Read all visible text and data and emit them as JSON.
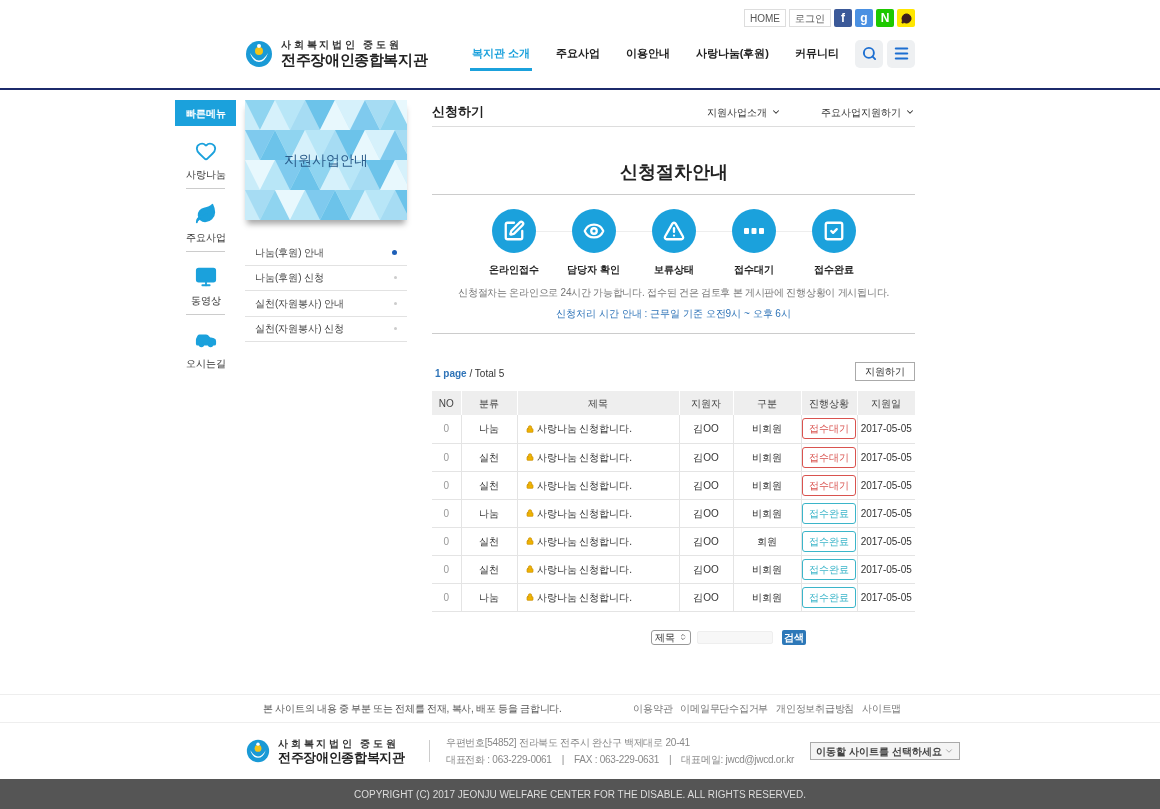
{
  "top_links": [
    {
      "label": "HOME"
    },
    {
      "label": "로그인"
    }
  ],
  "social": [
    {
      "kind": "facebook",
      "label": "f",
      "color": "#3b5998"
    },
    {
      "kind": "google",
      "label": "g",
      "color": "#4a90e2"
    },
    {
      "kind": "naver",
      "label": "N",
      "color": "#1ec800"
    },
    {
      "kind": "kakao",
      "color": "#ffe600"
    }
  ],
  "logo": {
    "subtitle": "사 회 복 지 법 인   중 도 원",
    "name": "전주장애인종합복지관"
  },
  "nav": [
    {
      "label": "복지관 소개",
      "selected": true
    },
    {
      "label": "주요사업",
      "selected": false
    },
    {
      "label": "이용안내",
      "selected": false
    },
    {
      "label": "사랑나눔(후원)",
      "selected": false
    },
    {
      "label": "커뮤니티",
      "selected": false
    }
  ],
  "quick_menu": {
    "title": "빠른메뉴",
    "items": [
      {
        "kind": "heart",
        "label": "사랑나눔"
      },
      {
        "kind": "leaf",
        "label": "주요사업"
      },
      {
        "kind": "monitor",
        "label": "동영상"
      },
      {
        "kind": "car",
        "label": "오시는길"
      }
    ]
  },
  "side": {
    "banner": "지원사업안내",
    "items": [
      {
        "label": "나눔(후원) 안내",
        "selected": true
      },
      {
        "label": "나눔(후원) 신청",
        "selected": false
      },
      {
        "label": "실천(자원봉사) 안내",
        "selected": false
      },
      {
        "label": "실천(자원봉사) 신청",
        "selected": false
      }
    ]
  },
  "page_title": "신청하기",
  "breadcrumbs": [
    {
      "label": "지원사업소개"
    },
    {
      "label": "주요사업지원하기"
    }
  ],
  "section_title": "신청절차안내",
  "steps": [
    {
      "kind": "edit",
      "label": "온라인접수"
    },
    {
      "kind": "eye",
      "label": "담당자 확인"
    },
    {
      "kind": "alert",
      "label": "보류상태"
    },
    {
      "kind": "dots",
      "label": "접수대기"
    },
    {
      "kind": "check",
      "label": "접수완료"
    }
  ],
  "notice": "신청절차는 온라인으로 24시간 가능합니다. 접수된 건은 검토후 본 게시판에 진행상황이 게시됩니다.",
  "hours": "신청처리 시간 안내 : 근무일 기준 오전9시 ~ 오후 6시",
  "board": {
    "page": "1 page",
    "total": " / Total 5",
    "apply_button": "지원하기",
    "columns": [
      "NO",
      "분류",
      "제목",
      "지원자",
      "구분",
      "진행상황",
      "지원일"
    ],
    "rows": [
      {
        "no": "0",
        "category": "나눔",
        "title": "사랑나눔 신청합니다.",
        "applicant": "김OO",
        "type": "비회원",
        "status": {
          "kind": "waiting",
          "label": "접수대기"
        },
        "date": "2017-05-05"
      },
      {
        "no": "0",
        "category": "실천",
        "title": "사랑나눔 신청합니다.",
        "applicant": "김OO",
        "type": "비회원",
        "status": {
          "kind": "waiting",
          "label": "접수대기"
        },
        "date": "2017-05-05"
      },
      {
        "no": "0",
        "category": "실천",
        "title": "사랑나눔 신청합니다.",
        "applicant": "김OO",
        "type": "비회원",
        "status": {
          "kind": "waiting",
          "label": "접수대기"
        },
        "date": "2017-05-05"
      },
      {
        "no": "0",
        "category": "나눔",
        "title": "사랑나눔 신청합니다.",
        "applicant": "김OO",
        "type": "비회원",
        "status": {
          "kind": "done",
          "label": "접수완료"
        },
        "date": "2017-05-05"
      },
      {
        "no": "0",
        "category": "실천",
        "title": "사랑나눔 신청합니다.",
        "applicant": "김OO",
        "type": "회원",
        "status": {
          "kind": "done",
          "label": "접수완료"
        },
        "date": "2017-05-05"
      },
      {
        "no": "0",
        "category": "실천",
        "title": "사랑나눔 신청합니다.",
        "applicant": "김OO",
        "type": "비회원",
        "status": {
          "kind": "done",
          "label": "접수완료"
        },
        "date": "2017-05-05"
      },
      {
        "no": "0",
        "category": "나눔",
        "title": "사랑나눔 신청합니다.",
        "applicant": "김OO",
        "type": "비회원",
        "status": {
          "kind": "done",
          "label": "접수완료"
        },
        "date": "2017-05-05"
      }
    ],
    "search": {
      "field": "제목",
      "button": "검색"
    }
  },
  "footer": {
    "notice": "본 사이트의 내용 중 부분 또는 전체를 전재, 복사, 배포 등을 금합니다.",
    "logo": {
      "subtitle": "사 회 복 지 법 인   중 도 원",
      "name": "전주장애인종합복지관"
    },
    "links": [
      "이용약관",
      "이메일무단수집거부",
      "개인정보취급방침",
      "사이트맵"
    ],
    "address": "우편번호[54852] 전라북도 전주시 완산구 백제대로 20-41",
    "contacts": [
      "대표전화 : 063-229-0061",
      "|",
      "FAX : 063-229-0631",
      "|",
      "대표메일: jwcd@jwcd.or.kr"
    ],
    "site_select": "이동할 사이트를 선택하세요",
    "copyright": "COPYRIGHT (C) 2017 JEONJU WELFARE CENTER FOR THE DISABLE. ALL RIGHTS RESERVED."
  }
}
